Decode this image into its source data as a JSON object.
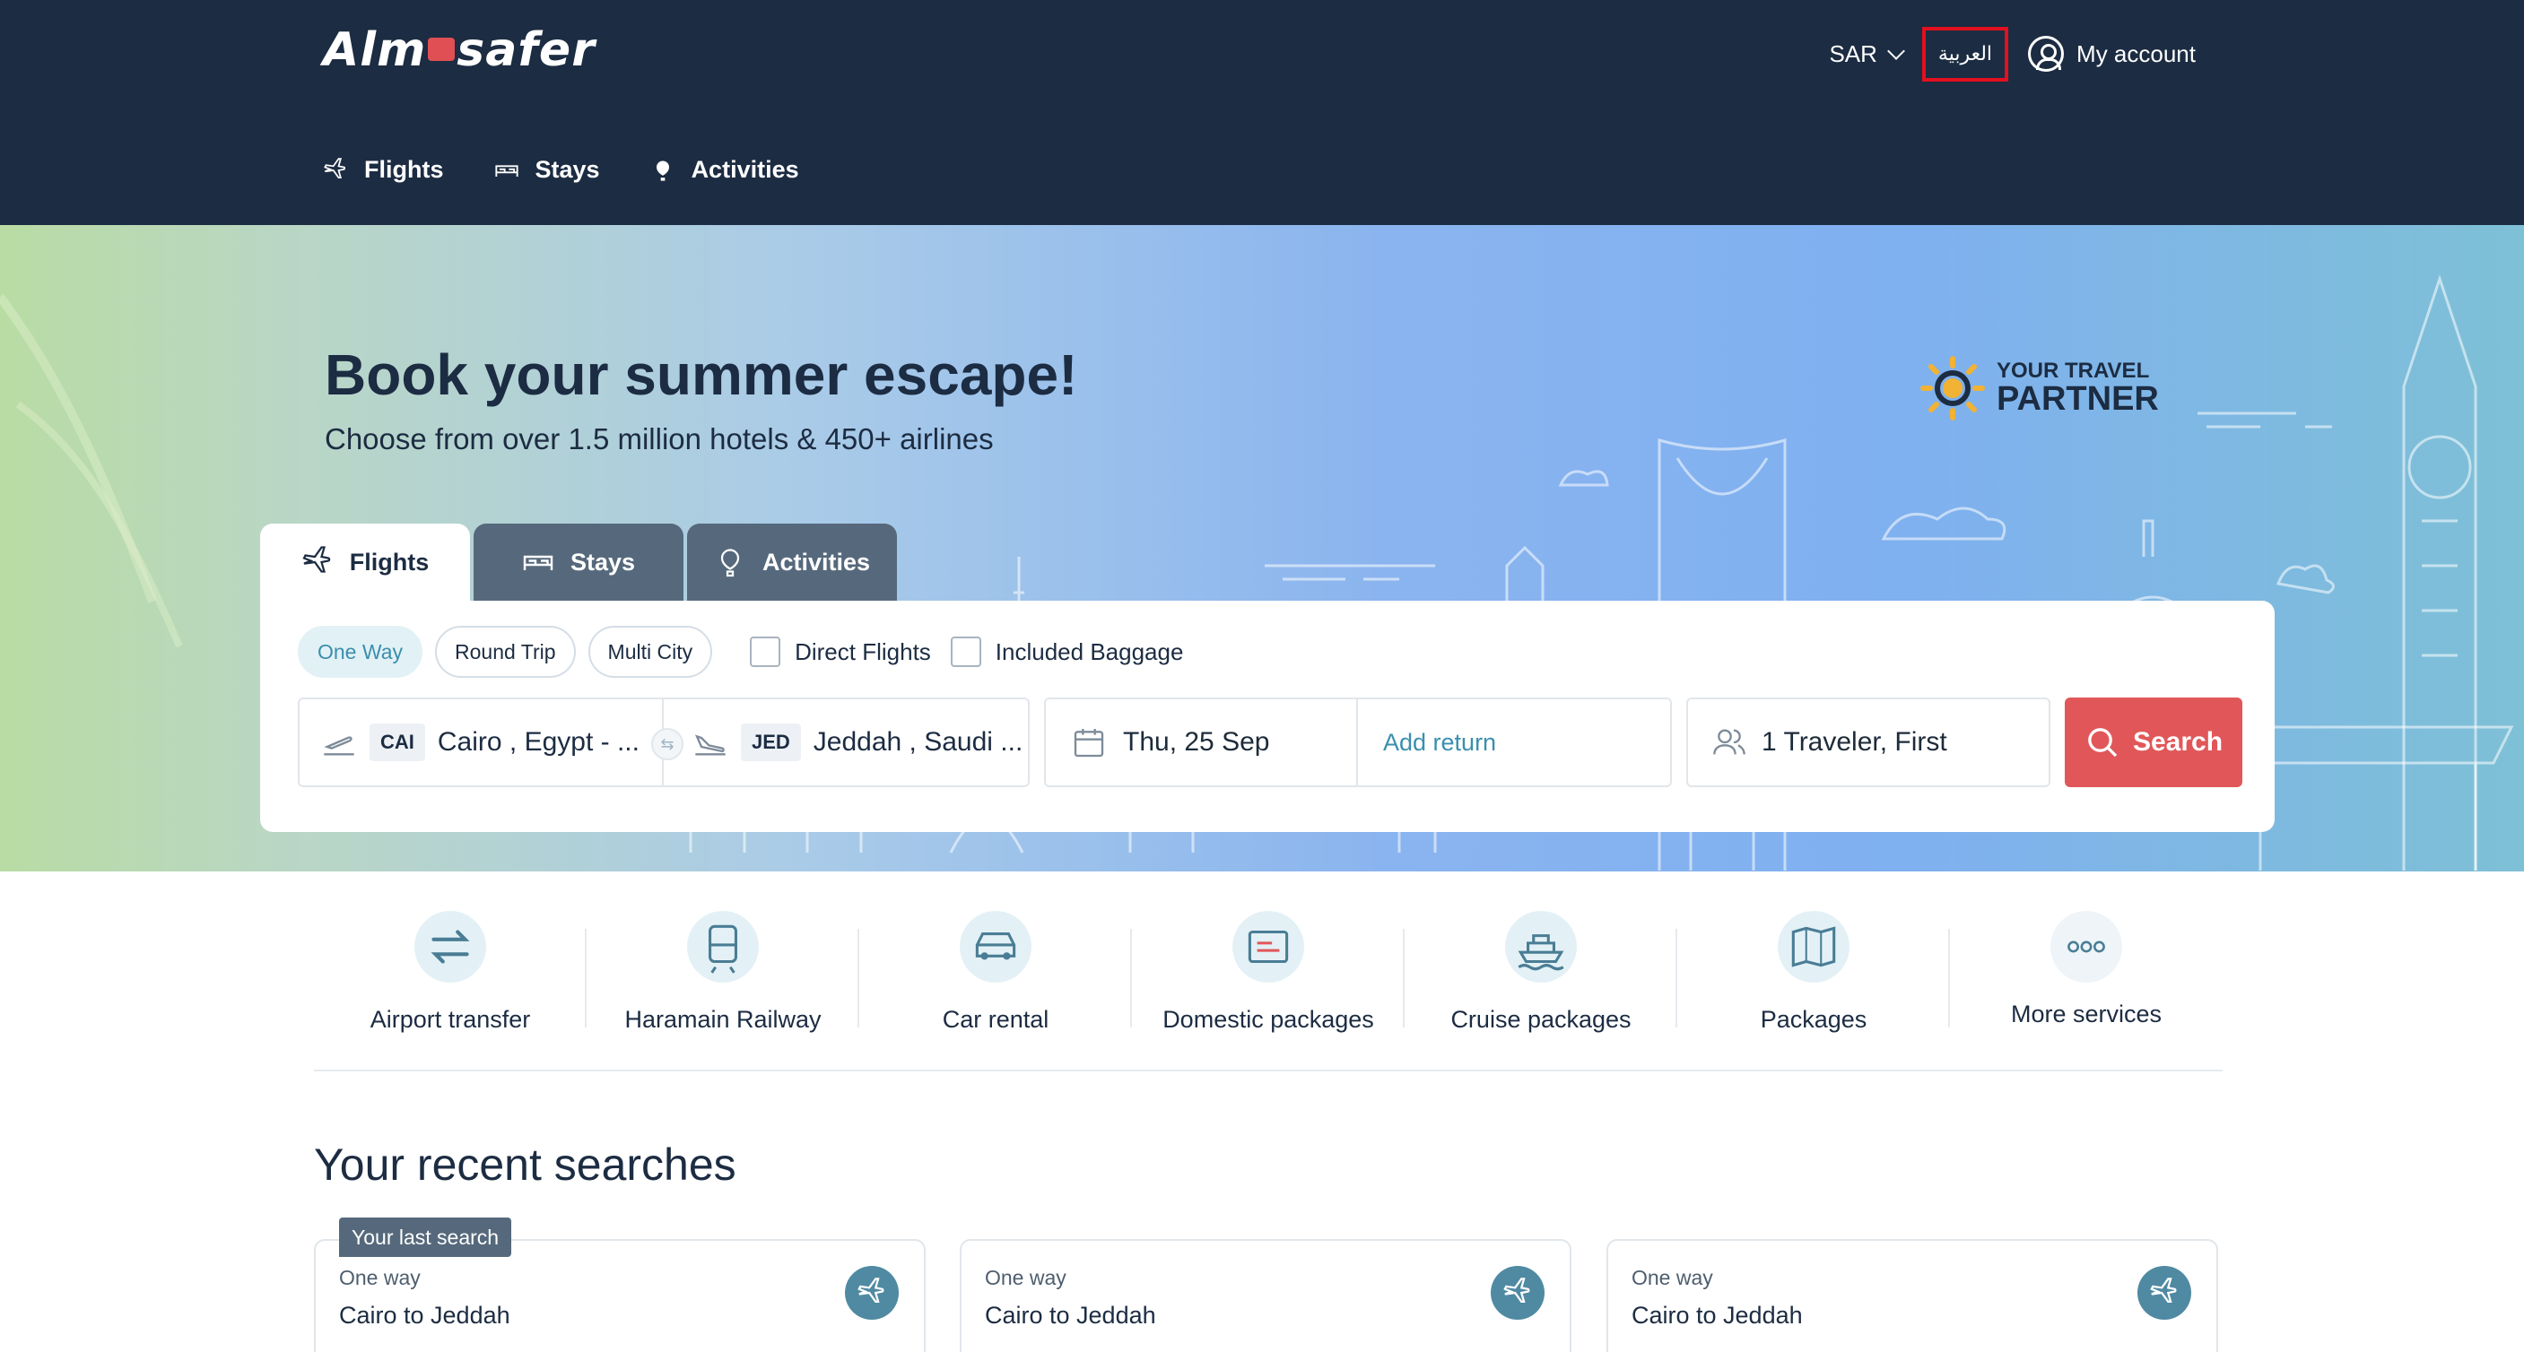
{
  "header": {
    "logo_left": "Alm",
    "logo_right": "safer",
    "currency": "SAR",
    "language": "العربية",
    "account": "My account",
    "nav": [
      {
        "label": "Flights",
        "icon": "plane-icon"
      },
      {
        "label": "Stays",
        "icon": "bed-icon"
      },
      {
        "label": "Activities",
        "icon": "balloon-icon"
      }
    ]
  },
  "hero": {
    "title": "Book your summer escape!",
    "subtitle": "Choose from over 1.5 million hotels & 450+ airlines",
    "partner_line1": "YOUR TRAVEL",
    "partner_line2": "PARTNER"
  },
  "search": {
    "tabs": [
      "Flights",
      "Stays",
      "Activities"
    ],
    "active_tab": "Flights",
    "trip_types": [
      "One Way",
      "Round Trip",
      "Multi City"
    ],
    "active_trip_type": "One Way",
    "direct_flights": "Direct Flights",
    "included_baggage": "Included Baggage",
    "from_code": "CAI",
    "from_city": "Cairo , Egypt - ...",
    "to_code": "JED",
    "to_city": "Jeddah , Saudi ...",
    "depart_date": "Thu, 25 Sep",
    "add_return": "Add return",
    "travelers": "1 Traveler, First",
    "search_label": "Search"
  },
  "services": [
    {
      "label": "Airport transfer",
      "icon": "transfer-icon"
    },
    {
      "label": "Haramain Railway",
      "icon": "train-icon"
    },
    {
      "label": "Car rental",
      "icon": "car-icon"
    },
    {
      "label": "Domestic packages",
      "icon": "ticket-icon"
    },
    {
      "label": "Cruise packages",
      "icon": "ship-icon"
    },
    {
      "label": "Packages",
      "icon": "map-icon"
    },
    {
      "label": "More services",
      "icon": "more-icon"
    }
  ],
  "recent": {
    "title": "Your recent searches",
    "badge": "Your last search",
    "cards": [
      {
        "type": "One way",
        "route": "Cairo to Jeddah"
      },
      {
        "type": "One way",
        "route": "Cairo to Jeddah"
      },
      {
        "type": "One way",
        "route": "Cairo to Jeddah"
      }
    ]
  },
  "colors": {
    "header_bg": "#1c2c42",
    "accent": "#3a8fae",
    "search_button": "#e15759",
    "tab_inactive": "#56697c"
  }
}
